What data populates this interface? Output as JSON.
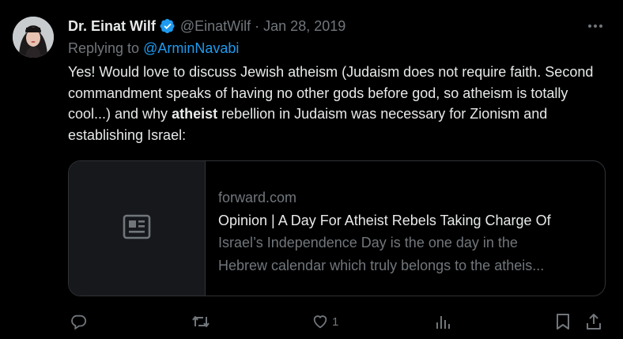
{
  "tweet": {
    "display_name": "Dr. Einat Wilf",
    "handle": "@EinatWilf",
    "separator": "·",
    "date": "Jan 28, 2019",
    "replying_prefix": "Replying to ",
    "replying_to": "@ArminNavabi",
    "text_part1": "Yes! Would love to discuss Jewish atheism (Judaism does not require faith. Second commandment speaks of having no other gods before god, so atheism is totally cool...) and why ",
    "text_bold": "atheist",
    "text_part2": " rebellion in Judaism was necessary for Zionism and establishing Israel:"
  },
  "card": {
    "domain": "forward.com",
    "title": "Opinion | A Day For Atheist Rebels Taking Charge Of",
    "description_line1": "Israel’s Independence Day is the one day in the",
    "description_line2": "Hebrew calendar which truly belongs to the atheis..."
  },
  "actions": {
    "likes": "1"
  },
  "icons": {
    "verified": "verified-badge-icon",
    "more": "more-dots-icon",
    "card_thumb": "article-icon",
    "reply": "reply-icon",
    "retweet": "retweet-icon",
    "like": "heart-icon",
    "views": "views-icon",
    "bookmark": "bookmark-icon",
    "share": "share-icon"
  },
  "colors": {
    "background": "#000000",
    "text": "#e7e9ea",
    "muted": "#71767b",
    "link": "#1d9bf0",
    "border": "#2f3336"
  }
}
